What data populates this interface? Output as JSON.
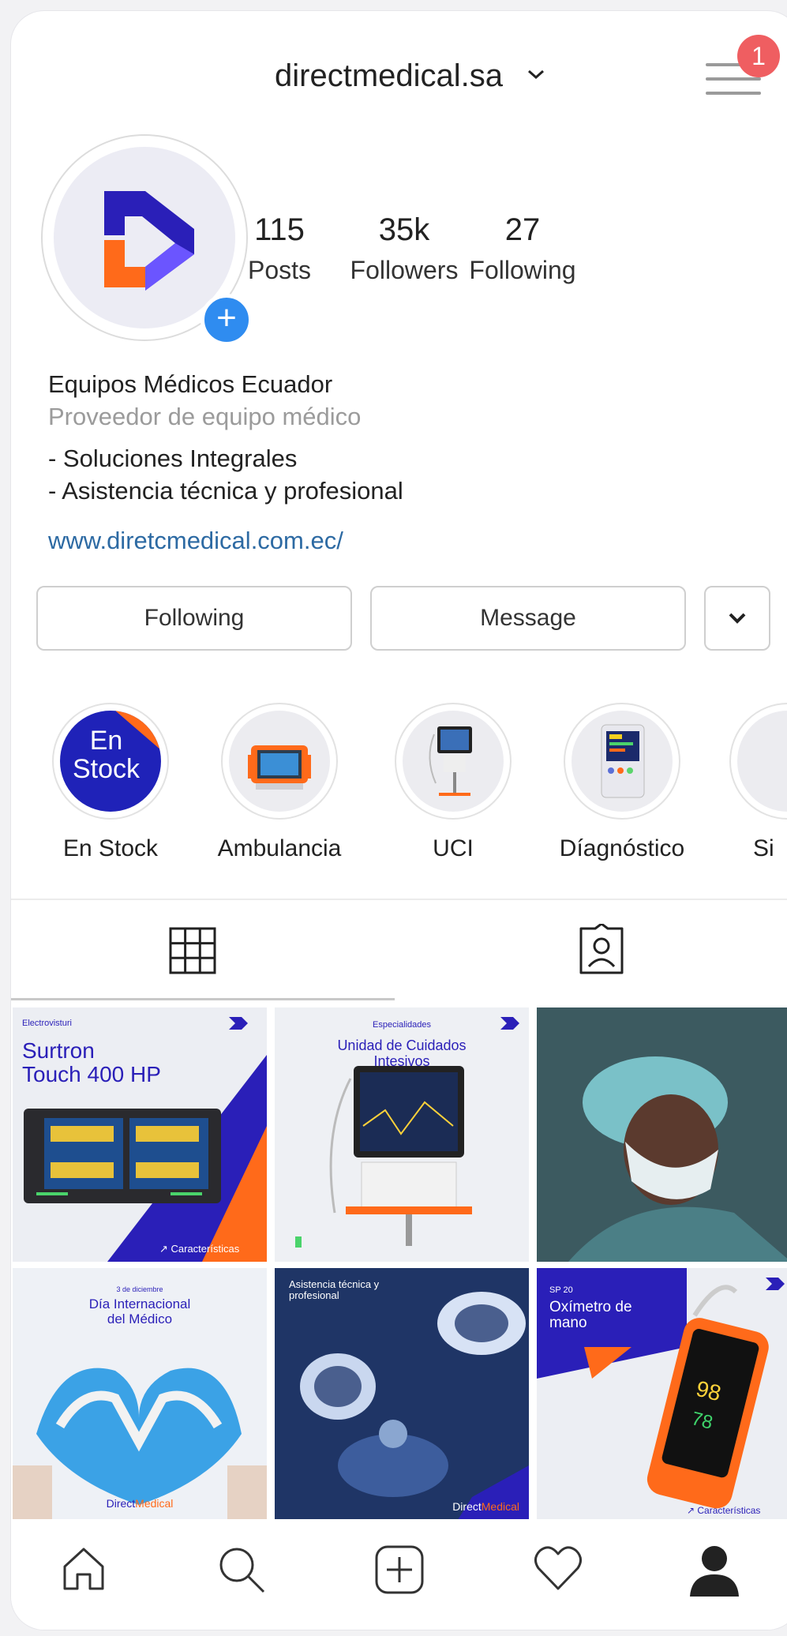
{
  "header": {
    "username": "directmedical.sa",
    "notification_count": "1"
  },
  "profile": {
    "posts_count": "115",
    "posts_label": "Posts",
    "followers_count": "35k",
    "followers_label": "Followers",
    "following_count": "27",
    "following_label": "Following"
  },
  "bio": {
    "name": "Equipos Médicos Ecuador",
    "category": "Proveedor de equipo médico",
    "line1": "- Soluciones Integrales",
    "line2": "- Asistencia técnica y profesional",
    "link": "www.diretcmedical.com.ec/"
  },
  "actions": {
    "following_label": "Following",
    "message_label": "Message"
  },
  "highlights": {
    "items": [
      {
        "label": "En Stock",
        "cover_text": "En\nStock"
      },
      {
        "label": "Ambulancia"
      },
      {
        "label": "UCI"
      },
      {
        "label": "Díagnóstico"
      },
      {
        "label": "Si"
      }
    ],
    "stock_line1": "En",
    "stock_line2": "Stock"
  },
  "posts": {
    "p1": {
      "small": "Electrovisturi",
      "title1": "Surtron",
      "title2": "Touch 400 HP",
      "cta": "↗ Características"
    },
    "p2": {
      "small": "Especialidades",
      "title1": "Unidad de Cuidados",
      "title2": "Intesivos"
    },
    "p4": {
      "small": "3 de diciembre",
      "title1": "Día Internacional",
      "title2": "del Médico",
      "brand1": "Direct",
      "brand2": "Medical"
    },
    "p5": {
      "title1": "Asistencia técnica y",
      "title2": "profesional",
      "brand1": "Direct",
      "brand2": "Medical"
    },
    "p6": {
      "small": "SP 20",
      "title1": "Oxímetro de",
      "title2": "mano",
      "reading1": "98",
      "reading2": "78",
      "cta": "↗ Características"
    }
  },
  "colors": {
    "brand_blue": "#1f22b8",
    "brand_orange": "#ff6a1a",
    "link_blue": "#2d6aa3",
    "notif_red": "#ef5e61",
    "add_blue": "#2f8cf0"
  },
  "icons": {
    "menu": "hamburger-icon",
    "chevron": "chevron-down-icon",
    "grid": "grid-icon",
    "tagged": "tagged-user-icon",
    "home": "home-icon",
    "search": "search-icon",
    "add": "add-post-icon",
    "heart": "heart-icon",
    "profile": "profile-icon"
  }
}
